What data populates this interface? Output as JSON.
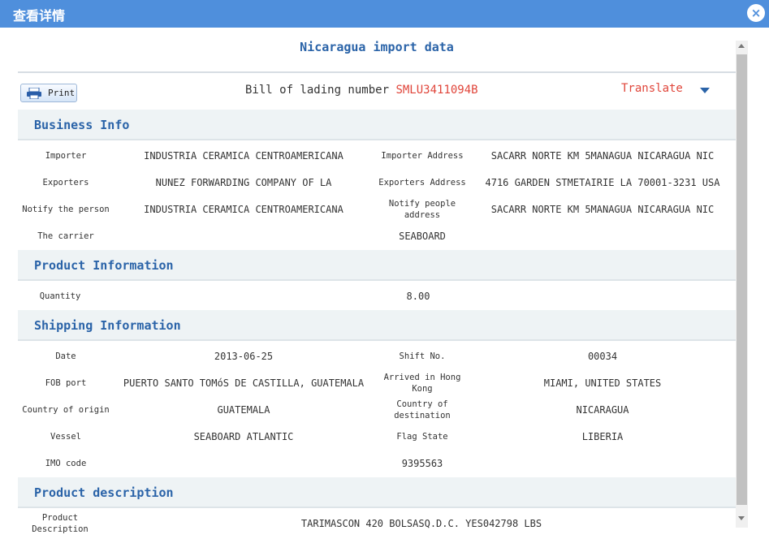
{
  "window": {
    "title": "查看详情",
    "close_glyph": "×"
  },
  "doc_title": "Nicaragua import data",
  "toolbar": {
    "print_label": "Print",
    "bol_label": "Bill of lading number",
    "bol_number": "SMLU3411094B",
    "translate_label": "Translate"
  },
  "business": {
    "heading": "Business Info",
    "importer_label": "Importer",
    "importer_value": "INDUSTRIA CERAMICA CENTROAMERICANA",
    "importer_address_label": "Importer Address",
    "importer_address_value": "SACARR NORTE KM 5MANAGUA NICARAGUA NIC",
    "exporters_label": "Exporters",
    "exporters_value": "NUNEZ FORWARDING COMPANY OF LA",
    "exporters_address_label": "Exporters Address",
    "exporters_address_value": "4716 GARDEN STMETAIRIE LA 70001-3231 USA",
    "notify_label": "Notify the person",
    "notify_value": "INDUSTRIA CERAMICA CENTROAMERICANA",
    "notify_address_label_1": "Notify people",
    "notify_address_label_2": "address",
    "notify_address_value": "SACARR NORTE KM 5MANAGUA NICARAGUA NIC",
    "carrier_label": "The carrier",
    "carrier_value": "SEABOARD"
  },
  "product": {
    "heading": "Product Information",
    "quantity_label": "Quantity",
    "quantity_value": "8.00"
  },
  "shipping": {
    "heading": "Shipping Information",
    "date_label": "Date",
    "date_value": "2013-06-25",
    "shift_label": "Shift No.",
    "shift_value": "00034",
    "fob_label": "FOB port",
    "fob_value": "PUERTO SANTO TOMóS DE CASTILLA, GUATEMALA",
    "arrived_label_1": "Arrived in Hong",
    "arrived_label_2": "Kong",
    "arrived_value": "MIAMI, UNITED STATES",
    "origin_label": "Country of origin",
    "origin_value": "GUATEMALA",
    "destination_label_1": "Country of",
    "destination_label_2": "destination",
    "destination_value": "NICARAGUA",
    "vessel_label": "Vessel",
    "vessel_value": "SEABOARD ATLANTIC",
    "flag_label": "Flag State",
    "flag_value": "LIBERIA",
    "imo_label": "IMO code",
    "imo_value": "9395563"
  },
  "description": {
    "heading": "Product description",
    "label_1": "Product",
    "label_2": "Description",
    "value": "TARIMASCON 420 BOLSASQ.D.C. YES042798 LBS"
  }
}
